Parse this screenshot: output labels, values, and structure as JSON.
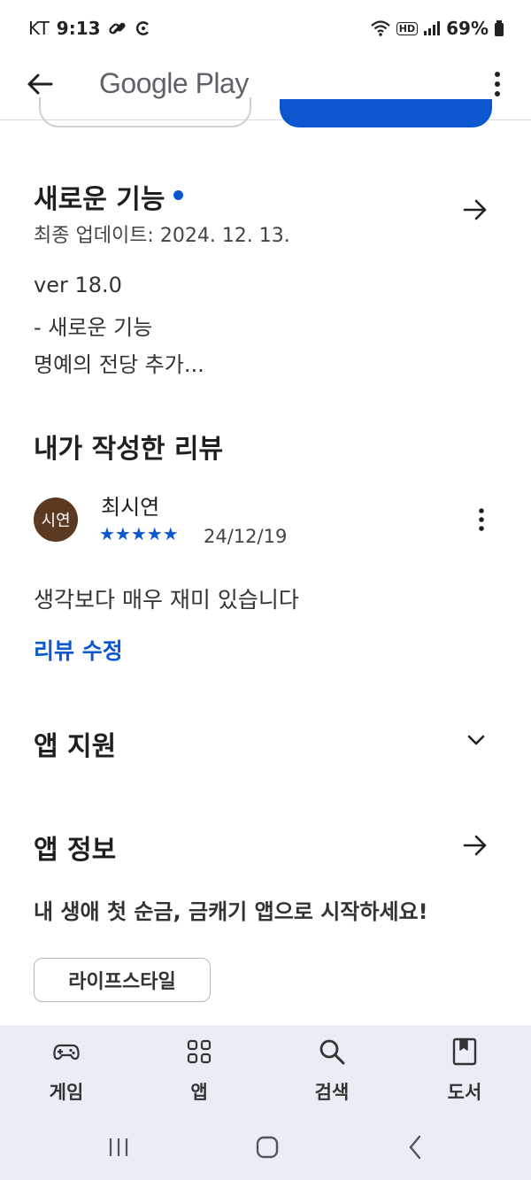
{
  "status_bar": {
    "carrier": "KT",
    "time": "9:13",
    "battery": "69%",
    "hd_label": "HD"
  },
  "app_bar": {
    "title": "Google Play"
  },
  "whats_new": {
    "title": "새로운 기능",
    "last_updated": "최종 업데이트: 2024. 12. 13.",
    "lines": [
      "ver 18.0",
      "- 새로운 기능",
      "명예의 전당 추가..."
    ]
  },
  "my_review": {
    "title": "내가 작성한 리뷰",
    "avatar_text": "시연",
    "reviewer_name": "최시연",
    "stars": "★★★★★",
    "rating": 5,
    "date": "24/12/19",
    "text": "생각보다 매우 재미 있습니다",
    "edit_label": "리뷰 수정"
  },
  "app_support": {
    "title": "앱 지원"
  },
  "app_info": {
    "title": "앱 정보",
    "description": "내 생애 첫 순금, 금캐기 앱으로 시작하세요!",
    "category_chip": "라이프스타일"
  },
  "bottom_nav": {
    "items": [
      {
        "label": "게임",
        "icon": "gamepad-icon"
      },
      {
        "label": "앱",
        "icon": "apps-grid-icon"
      },
      {
        "label": "검색",
        "icon": "search-icon"
      },
      {
        "label": "도서",
        "icon": "book-icon"
      }
    ]
  },
  "colors": {
    "accent": "#0b57d0",
    "nav_bg": "#e9eef6",
    "avatar_bg": "#5b3a22"
  }
}
